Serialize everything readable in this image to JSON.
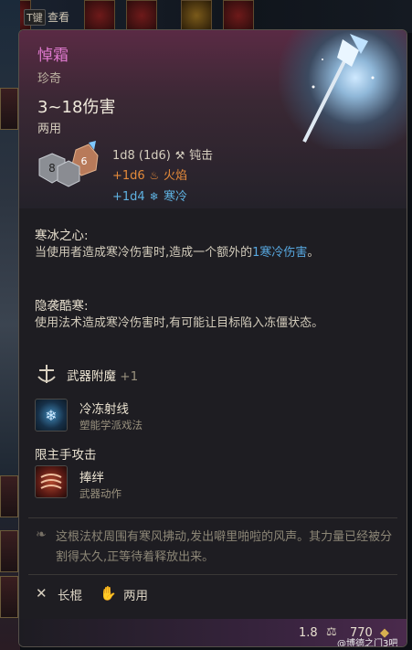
{
  "hud": {
    "key_hint": "T键",
    "view_label": "查看"
  },
  "item": {
    "name": "悼霜",
    "rarity": "珍奇",
    "damage": "3~18伤害",
    "hands": "两用",
    "dice_values": [
      "8",
      "6"
    ],
    "damage_lines": {
      "base": "1d8 (1d6)",
      "base_type": "钝击",
      "fire": "+1d6",
      "fire_type": "火焰",
      "cold": "+1d4",
      "cold_type": "寒冷"
    }
  },
  "sections": {
    "heart": {
      "title": "寒冰之心:",
      "text_before": "当使用者造成寒冷伤害时,造成一个额外的",
      "text_highlight": "1寒冷伤害",
      "text_after": "。"
    },
    "chill": {
      "title": "隐袭酷寒:",
      "text": "使用法术造成寒冷伤害时,有可能让目标陷入冻僵状态。"
    },
    "enchant": {
      "label": "武器附魔",
      "value": "+1"
    },
    "ray": {
      "title": "冷冻射线",
      "subtitle": "塑能学派戏法"
    },
    "mainhand_header": "限主手攻击",
    "shackle": {
      "title": "捧绊",
      "subtitle": "武器动作"
    }
  },
  "lore": "这根法杖周围有寒风拂动,发出噼里啪啦的风声。其力量已经被分割得太久,正等待着释放出来。",
  "footer": {
    "weapon_type": "长棍",
    "handedness": "两用"
  },
  "bottom_bar": {
    "weight": "1.8",
    "price": "770",
    "watermark": "@博德之门3吧"
  },
  "colors": {
    "item_name": "#e07ad0",
    "fire": "#e48a3a",
    "cold": "#5fb2e2",
    "highlight_blue": "#57a8e0"
  },
  "icons": {
    "mace": "mace-icon",
    "fire": "flame-icon",
    "cold": "snowflake-icon",
    "enchant": "enchant-icon",
    "staff": "staff-icon",
    "hand": "hand-icon",
    "weight": "weight-icon",
    "coin": "coin-icon"
  }
}
